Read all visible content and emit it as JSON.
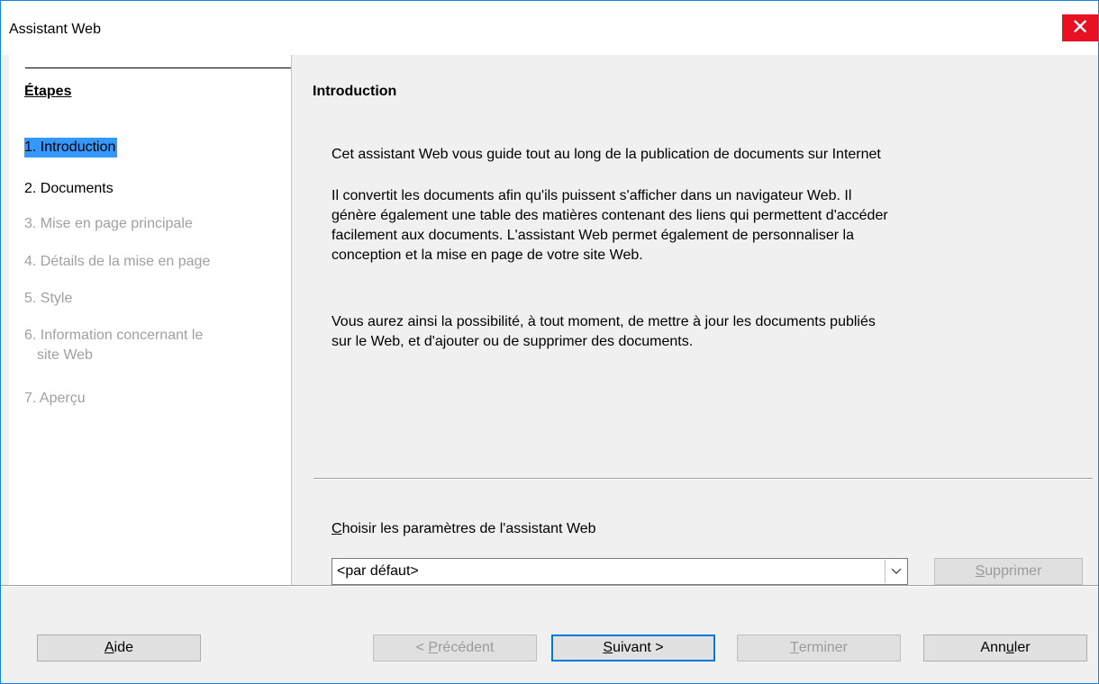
{
  "window": {
    "title": "Assistant Web",
    "close_label": "✕"
  },
  "sidebar": {
    "title": "Étapes",
    "steps": [
      {
        "label": "1. Introduction",
        "state": "active"
      },
      {
        "label": "2. Documents",
        "state": "enabled"
      },
      {
        "label": "3. Mise en page principale",
        "state": "disabled"
      },
      {
        "label": "4. Détails de la mise en page",
        "state": "disabled"
      },
      {
        "label": "5. Style",
        "state": "disabled"
      },
      {
        "label_line1": "6. Information concernant le",
        "label_line2": "site Web",
        "state": "disabled"
      },
      {
        "label": "7. Aperçu",
        "state": "disabled"
      }
    ]
  },
  "main": {
    "title": "Introduction",
    "paragraph1": "Cet assistant Web vous guide tout au long de la publication de documents sur Internet",
    "paragraph2_lines": [
      "Il convertit les documents afin qu'ils puissent s'afficher dans un navigateur Web. Il",
      "génère également une table des matières contenant des liens qui permettent d'accéder",
      "facilement aux documents. L'assistant Web permet également de personnaliser la",
      "conception et la mise en page de votre site Web."
    ],
    "paragraph3_lines": [
      "Vous aurez ainsi la possibilité, à tout moment, de mettre à jour les documents publiés",
      "sur le Web, et d'ajouter ou de supprimer des documents."
    ],
    "settings": {
      "label_mnemonic": "C",
      "label_rest": "hoisir les paramètres de l'assistant Web",
      "selected_value": "<par défaut>",
      "delete_mnemonic": "S",
      "delete_rest": "upprimer"
    }
  },
  "footer": {
    "help_mnemonic": "A",
    "help_rest": "ide",
    "prev_prefix": "< ",
    "prev_mnemonic": "P",
    "prev_rest": "récédent",
    "next_mnemonic": "S",
    "next_rest": "uivant >",
    "finish_mnemonic": "T",
    "finish_rest": "erminer",
    "cancel_pre": "Ann",
    "cancel_mnemonic": "u",
    "cancel_rest": "ler"
  },
  "colors": {
    "accent": "#0078d7",
    "selection": "#3399ff",
    "close": "#e81123",
    "disabled_text": "#a0a0a0"
  }
}
